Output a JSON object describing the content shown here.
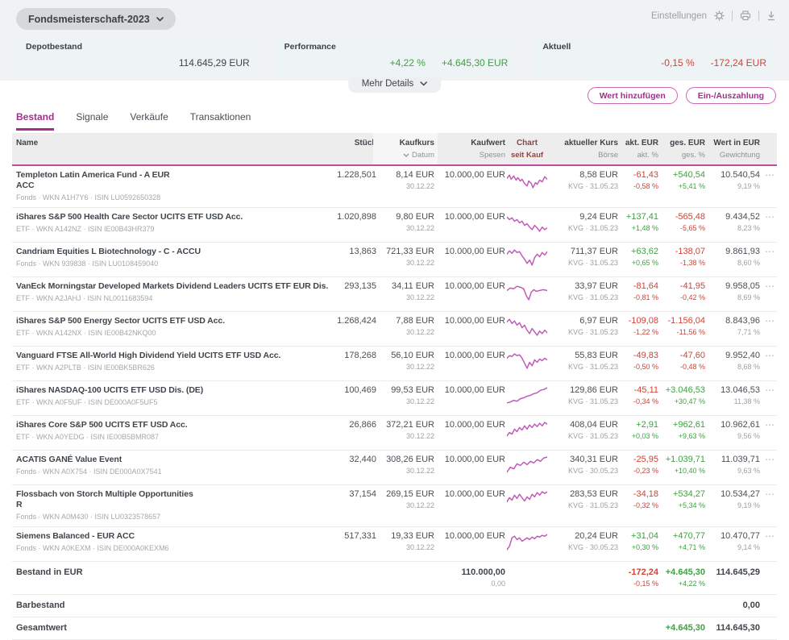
{
  "colors": {
    "accent": "#a82b90",
    "pos": "#3fa142",
    "neg": "#cc4538",
    "spark": "#c158b8"
  },
  "icons": {
    "gear": "⚙",
    "printer": "⎙",
    "download": "⤓",
    "chevron_down": "⌄",
    "row_menu": "⋯"
  },
  "header": {
    "portfolio_name": "Fondsmeisterschaft-2023",
    "settings_label": "Einstellungen",
    "more_details_label": "Mehr Details",
    "cards": {
      "depot": {
        "label": "Depotbestand",
        "value": "114.645,29 EUR"
      },
      "performance": {
        "label": "Performance",
        "pct": "+4,22 %",
        "value": "+4.645,30 EUR",
        "sign": "pos"
      },
      "aktuell": {
        "label": "Aktuell",
        "pct": "-0,15 %",
        "value": "-172,24 EUR",
        "sign": "neg"
      }
    },
    "actions": [
      {
        "label": "Wert hinzufügen"
      },
      {
        "label": "Ein-/Auszahlung"
      }
    ]
  },
  "tabs": [
    {
      "label": "Bestand",
      "active": "true"
    },
    {
      "label": "Signale",
      "active": "false"
    },
    {
      "label": "Verkäufe",
      "active": "false"
    },
    {
      "label": "Transaktionen",
      "active": "false"
    }
  ],
  "table": {
    "menu_label": "⋯",
    "columns": {
      "name": "Name",
      "stueck": "Stück",
      "kaufkurs": "Kaufkurs",
      "kaufkurs_sub": "Datum",
      "kaufwert": "Kaufwert",
      "kaufwert_sub": "Spesen",
      "chart": "Chart",
      "chart_sub": "seit Kauf",
      "kurs": "aktueller Kurs",
      "kurs_sub": "Börse",
      "akt": "akt. EUR",
      "akt_sub": "akt. %",
      "ges": "ges. EUR",
      "ges_sub": "ges. %",
      "wert": "Wert in EUR",
      "wert_sub": "Gewichtung"
    }
  },
  "rows": [
    {
      "name": "Templeton Latin America Fund - A EUR",
      "name2": "ACC",
      "meta": "Fonds · WKN A1H7Y6 · ISIN LU0592650328",
      "stueck": "1.228,501",
      "kaufkurs": "8,14 EUR",
      "kauf_datum": "30.12.22",
      "kaufwert": "10.000,00 EUR",
      "spark": "0,9 3,5 5,10 8,6 11,11 13,8 16,12 18,10 21,15 24,18 26,12 29,15 31,20 34,14 36,16 39,11 42,13 45,7 48,10",
      "kurs": "8,58 EUR",
      "kurs_src": "KVG · 31.05.23",
      "akt": "-61,43",
      "akt_pct": "-0,58 %",
      "akt_sign": "neg",
      "ges": "+540,54",
      "ges_pct": "+5,41 %",
      "ges_sign": "pos",
      "wert": "10.540,54",
      "gewichtung": "9,19 %"
    },
    {
      "name": "iShares S&P 500 Health Care Sector UCITS ETF USD Acc.",
      "name2": "",
      "meta": "ETF · WKN A142NZ · ISIN IE00B43HR379",
      "stueck": "1.020,898",
      "kaufkurs": "9,80 EUR",
      "kauf_datum": "30.12.22",
      "kaufwert": "10.000,00 EUR",
      "spark": "0,5 3,8 6,6 9,10 12,8 15,12 18,10 21,15 24,13 27,17 30,20 33,15 36,18 39,22 42,17 45,20 48,18",
      "kurs": "9,24 EUR",
      "kurs_src": "KVG · 31.05.23",
      "akt": "+137,41",
      "akt_pct": "+1,48 %",
      "akt_sign": "pos",
      "ges": "-565,48",
      "ges_pct": "-5,65 %",
      "ges_sign": "neg",
      "wert": "9.434,52",
      "gewichtung": "8,23 %"
    },
    {
      "name": "Candriam Equities L Biotechnology - C - ACCU",
      "name2": "",
      "meta": "Fonds · WKN 939838 · ISIN LU0108459040",
      "stueck": "13,863",
      "kaufkurs": "721,33 EUR",
      "kauf_datum": "30.12.22",
      "kaufwert": "10.000,00 EUR",
      "spark": "0,8 3,4 6,7 9,3 12,6 15,5 18,10 21,14 24,19 27,15 30,21 33,12 36,8 39,11 42,6 45,9 48,5",
      "kurs": "711,37 EUR",
      "kurs_src": "KVG · 31.05.23",
      "akt": "+63,62",
      "akt_pct": "+0,65 %",
      "akt_sign": "pos",
      "ges": "-138,07",
      "ges_pct": "-1,38 %",
      "ges_sign": "neg",
      "wert": "9.861,93",
      "gewichtung": "8,60 %"
    },
    {
      "name": "VanEck Morningstar Developed Markets Dividend Leaders UCITS ETF EUR Dis.",
      "name2": "",
      "meta": "ETF · WKN A2JAHJ · ISIN NL0011683594",
      "stueck": "293,135",
      "kaufkurs": "34,11 EUR",
      "kauf_datum": "30.12.22",
      "kaufwert": "10.000,00 EUR",
      "spark": "0,10 4,7 8,8 12,5 16,6 20,8 23,16 26,21 29,12 32,9 35,11 39,10 43,9 48,10",
      "kurs": "33,97 EUR",
      "kurs_src": "KVG · 31.05.23",
      "akt": "-81,64",
      "akt_pct": "-0,81 %",
      "akt_sign": "neg",
      "ges": "-41,95",
      "ges_pct": "-0,42 %",
      "ges_sign": "neg",
      "wert": "9.958,05",
      "gewichtung": "8,69 %"
    },
    {
      "name": "iShares S&P 500 Energy Sector UCITS ETF USD Acc.",
      "name2": "",
      "meta": "ETF · WKN A142NX · ISIN IE00B42NKQ00",
      "stueck": "1.268,424",
      "kaufkurs": "7,88 EUR",
      "kauf_datum": "30.12.22",
      "kaufwert": "10.000,00 EUR",
      "spark": "0,6 3,3 6,8 9,5 12,10 15,7 18,13 21,10 24,16 27,20 30,14 33,18 36,22 39,17 42,20 45,16 48,19",
      "kurs": "6,97 EUR",
      "kurs_src": "KVG · 31.05.23",
      "akt": "-109,08",
      "akt_pct": "-1,22 %",
      "akt_sign": "neg",
      "ges": "-1.156,04",
      "ges_pct": "-11,56 %",
      "ges_sign": "neg",
      "wert": "8.843,96",
      "gewichtung": "7,71 %"
    },
    {
      "name": "Vanguard FTSE All-World High Dividend Yield UCITS ETF USD Acc.",
      "name2": "",
      "meta": "ETF · WKN A2PLTB · ISIN IE00BK5BR626",
      "stueck": "178,268",
      "kaufkurs": "56,10 EUR",
      "kauf_datum": "30.12.22",
      "kaufwert": "10.000,00 EUR",
      "spark": "0,8 3,5 6,6 9,3 12,5 15,4 18,8 21,14 24,20 27,13 30,17 33,10 36,13 39,9 42,11 45,8 48,10",
      "kurs": "55,83 EUR",
      "kurs_src": "KVG · 31.05.23",
      "akt": "-49,83",
      "akt_pct": "-0,50 %",
      "akt_sign": "neg",
      "ges": "-47,60",
      "ges_pct": "-0,48 %",
      "ges_sign": "neg",
      "wert": "9.952,40",
      "gewichtung": "8,68 %"
    },
    {
      "name": "iShares NASDAQ-100 UCITS ETF USD Dis. (DE)",
      "name2": "",
      "meta": "ETF · WKN A0F5UF · ISIN DE000A0F5UF5",
      "stueck": "100,469",
      "kaufkurs": "99,53 EUR",
      "kauf_datum": "30.12.22",
      "kaufwert": "10.000,00 EUR",
      "spark": "0,20 4,19 8,17 12,18 16,15 20,14 24,12 28,11 32,9 36,8 40,5 44,4 48,2",
      "kurs": "129,86 EUR",
      "kurs_src": "KVG · 31.05.23",
      "akt": "-45,11",
      "akt_pct": "-0,34 %",
      "akt_sign": "neg",
      "ges": "+3.046,53",
      "ges_pct": "+30,47 %",
      "ges_sign": "pos",
      "wert": "13.046,53",
      "gewichtung": "11,38 %"
    },
    {
      "name": "iShares Core S&P 500 UCITS ETF USD Acc.",
      "name2": "",
      "meta": "ETF · WKN A0YEDG · ISIN IE00B5BMR087",
      "stueck": "26,866",
      "kaufkurs": "372,21 EUR",
      "kauf_datum": "30.12.22",
      "kaufwert": "10.000,00 EUR",
      "spark": "0,18 3,14 6,16 9,10 12,13 15,8 18,11 21,6 24,10 27,5 30,8 33,4 36,7 39,3 42,6 45,2 48,4",
      "kurs": "408,04 EUR",
      "kurs_src": "KVG · 31.05.23",
      "akt": "+2,91",
      "akt_pct": "+0,03 %",
      "akt_sign": "pos",
      "ges": "+962,61",
      "ges_pct": "+9,63 %",
      "ges_sign": "pos",
      "wert": "10.962,61",
      "gewichtung": "9,56 %"
    },
    {
      "name": "ACATIS GANÉ Value Event",
      "name2": "",
      "meta": "Fonds · WKN A0X754 · ISIN DE000A0X7541",
      "stueck": "32,440",
      "kaufkurs": "308,26 EUR",
      "kauf_datum": "30.12.22",
      "kaufwert": "10.000,00 EUR",
      "spark": "0,20 4,14 8,16 12,10 16,12 20,8 24,11 28,7 32,9 36,5 40,7 44,3 48,2",
      "kurs": "340,31 EUR",
      "kurs_src": "KVG · 30.05.23",
      "akt": "-25,95",
      "akt_pct": "-0,23 %",
      "akt_sign": "neg",
      "ges": "+1.039,71",
      "ges_pct": "+10,40 %",
      "ges_sign": "pos",
      "wert": "11.039,71",
      "gewichtung": "9,63 %"
    },
    {
      "name": "Flossbach von Storch Multiple Opportunities",
      "name2": "R",
      "meta": "Fonds · WKN A0M430 · ISIN LU0323578657",
      "stueck": "37,154",
      "kaufkurs": "269,15 EUR",
      "kauf_datum": "30.12.22",
      "kaufwert": "10.000,00 EUR",
      "spark": "0,14 3,9 6,12 9,6 12,10 15,5 18,9 21,13 24,8 27,11 30,5 33,8 36,3 39,6 42,2 45,4 48,2",
      "kurs": "283,53 EUR",
      "kurs_src": "KVG · 31.05.23",
      "akt": "-34,18",
      "akt_pct": "-0,32 %",
      "akt_sign": "neg",
      "ges": "+534,27",
      "ges_pct": "+5,34 %",
      "ges_sign": "pos",
      "wert": "10.534,27",
      "gewichtung": "9,19 %"
    },
    {
      "name": "Siemens Balanced - EUR ACC",
      "name2": "",
      "meta": "Fonds · WKN A0KEXM · ISIN DE000A0KEXM6",
      "stueck": "517,331",
      "kaufkurs": "19,33 EUR",
      "kauf_datum": "30.12.22",
      "kaufwert": "10.000,00 EUR",
      "spark": "0,21 3,17 6,7 9,5 12,9 15,7 18,11 21,9 24,7 27,9 30,6 33,8 36,5 39,6 42,4 45,5 48,3",
      "kurs": "20,24 EUR",
      "kurs_src": "KVG · 30.05.23",
      "akt": "+31,04",
      "akt_pct": "+0,30 %",
      "akt_sign": "pos",
      "ges": "+470,77",
      "ges_pct": "+4,71 %",
      "ges_sign": "pos",
      "wert": "10.470,77",
      "gewichtung": "9,14 %"
    }
  ],
  "summary": {
    "bestand": {
      "label": "Bestand in EUR",
      "kaufwert": "110.000,00",
      "spesen": "0,00",
      "akt": "-172,24",
      "akt_pct": "-0,15 %",
      "ges": "+4.645,30",
      "ges_pct": "+4,22 %",
      "wert": "114.645,29"
    },
    "barbestand": {
      "label": "Barbestand",
      "wert": "0,00"
    },
    "gesamtwert": {
      "label": "Gesamtwert",
      "ges": "+4.645,30",
      "wert": "114.645,30"
    }
  }
}
